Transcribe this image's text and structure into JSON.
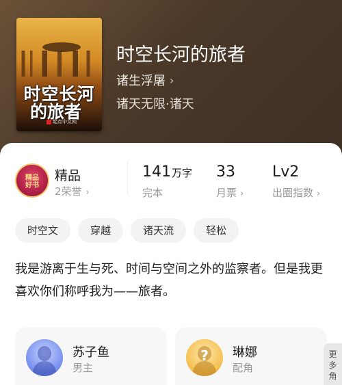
{
  "book": {
    "cover_title_line1": "时空长河",
    "cover_title_line2": "的旅者",
    "cover_publisher": "起点中文网",
    "title": "时空长河的旅者",
    "author": "诸生浮屠",
    "genre": "诸天无限·诸天"
  },
  "honor": {
    "badge_text_line1": "精品",
    "badge_text_line2": "好书",
    "title": "精品",
    "sub": "2荣誉"
  },
  "stats": [
    {
      "value": "141",
      "unit": "万字",
      "label": "完本"
    },
    {
      "value": "33",
      "unit": "",
      "label": "月票"
    },
    {
      "value": "Lv2",
      "unit": "",
      "label": "出圈指数"
    }
  ],
  "tags": [
    "时空文",
    "穿越",
    "诸天流",
    "轻松"
  ],
  "description": "我是游离于生与死、时间与空间之外的监察者。但是我更喜欢你们称呼我为——旅者。",
  "characters": [
    {
      "name": "苏子鱼",
      "role": "男主"
    },
    {
      "name": "琳娜",
      "role": "配角"
    }
  ],
  "more_label": "更多角",
  "icons": {
    "chevron": "chevron-right-icon",
    "question": "question-mark-icon"
  }
}
